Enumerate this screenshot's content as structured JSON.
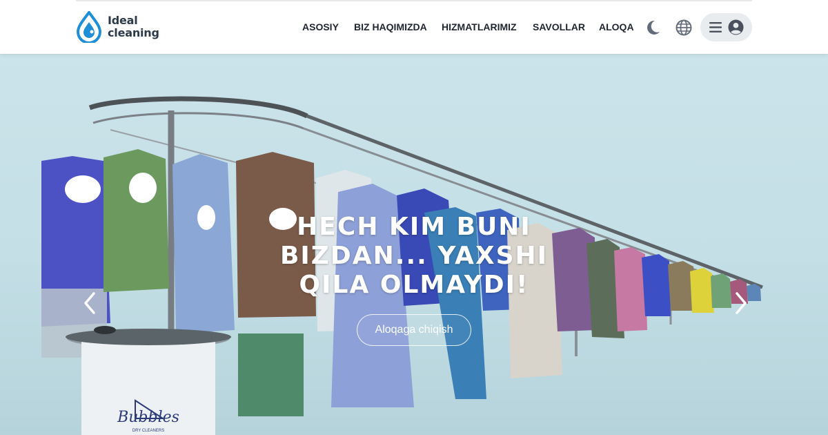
{
  "header": {
    "logo": {
      "line1": "Ideal",
      "line2": "cleaning",
      "icon": "water-drop-logo-icon",
      "color": "#1e8fd6"
    },
    "nav": [
      {
        "label": "ASOSIY"
      },
      {
        "label": "BIZ HAQIMIZDA"
      },
      {
        "label": "HIZMATLARIMIZ"
      },
      {
        "label": "SAVOLLAR"
      },
      {
        "label": "ALOQA"
      }
    ],
    "icons": {
      "theme": "moon-icon",
      "language": "globe-icon",
      "menu": "hamburger-menu-icon",
      "user": "user-circle-icon"
    }
  },
  "hero": {
    "title": "HECH KIM BUNI BIZDAN... YAXSHI QILA OLMAYDI!",
    "cta_label": "Aloqaga chiqish",
    "prev_icon": "chevron-left-icon",
    "next_icon": "chevron-right-icon",
    "brand_sign": {
      "text": "Bubbles",
      "subtext": "DRY CLEANERS"
    }
  },
  "colors": {
    "accent": "#1e8fd6",
    "nav_text": "#1f2630",
    "hero_bg": "#c4dfe6"
  }
}
